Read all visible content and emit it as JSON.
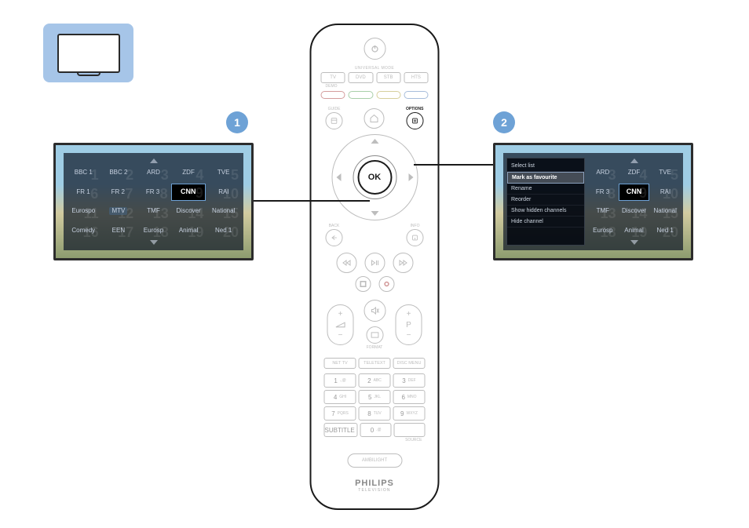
{
  "steps": {
    "one": "1",
    "two": "2"
  },
  "channel_grid": {
    "rows": [
      [
        {
          "label": "BBC 1",
          "num": "1"
        },
        {
          "label": "BBC 2",
          "num": "2"
        },
        {
          "label": "ARD",
          "num": "3"
        },
        {
          "label": "ZDF",
          "num": "4"
        },
        {
          "label": "TVE",
          "num": "5"
        }
      ],
      [
        {
          "label": "FR 1",
          "num": "6"
        },
        {
          "label": "FR 2",
          "num": "7"
        },
        {
          "label": "FR 3",
          "num": "8"
        },
        {
          "label": "CNN",
          "num": "9",
          "selected": true
        },
        {
          "label": "RAI",
          "num": "10"
        }
      ],
      [
        {
          "label": "Eurospo",
          "num": "11"
        },
        {
          "label": "MTV",
          "num": "12",
          "hover": true
        },
        {
          "label": "TMF",
          "num": "13"
        },
        {
          "label": "Discover",
          "num": "14"
        },
        {
          "label": "National",
          "num": "15"
        }
      ],
      [
        {
          "label": "Comedy",
          "num": "16"
        },
        {
          "label": "EEN",
          "num": "17"
        },
        {
          "label": "Eurosp",
          "num": "18"
        },
        {
          "label": "Animal",
          "num": "19"
        },
        {
          "label": "Ned 1",
          "num": "20"
        }
      ]
    ]
  },
  "options_menu": {
    "items": [
      {
        "label": "Select list"
      },
      {
        "label": "Mark as favourite",
        "selected": true
      },
      {
        "label": "Rename"
      },
      {
        "label": "Reorder"
      },
      {
        "label": "Show hidden channels"
      },
      {
        "label": "Hide channel"
      }
    ]
  },
  "channel_grid_right": {
    "rows": [
      [
        {
          "label": "ARD",
          "num": "3"
        },
        {
          "label": "ZDF",
          "num": "4"
        },
        {
          "label": "TVE",
          "num": "5"
        }
      ],
      [
        {
          "label": "FR 3",
          "num": "8"
        },
        {
          "label": "CNN",
          "num": "9",
          "selected": true
        },
        {
          "label": "RAI",
          "num": "10"
        }
      ],
      [
        {
          "label": "TMF",
          "num": "13"
        },
        {
          "label": "Discover",
          "num": "14"
        },
        {
          "label": "National",
          "num": "15"
        }
      ],
      [
        {
          "label": "Eurosp",
          "num": "18"
        },
        {
          "label": "Animal",
          "num": "19"
        },
        {
          "label": "Ned 1",
          "num": "20"
        }
      ]
    ]
  },
  "remote": {
    "universal_label": "UNIVERSAL MODE",
    "mode_buttons": [
      "TV",
      "DVD",
      "STB",
      "HTS"
    ],
    "mode_sub": "DEMO",
    "guide_label": "GUIDE",
    "options_label": "OPTIONS",
    "ok_label": "OK",
    "back_label": "BACK",
    "info_label": "INFO",
    "vol_plus": "+",
    "vol_minus": "−",
    "prog_label": "P",
    "format_label": "FORMAT",
    "fn_buttons": [
      "NET TV",
      "TELETEXT",
      "DISC MENU"
    ],
    "keypad": [
      [
        {
          "n": "1",
          "t": ".,@"
        },
        {
          "n": "2",
          "t": "ABC"
        },
        {
          "n": "3",
          "t": "DEF"
        }
      ],
      [
        {
          "n": "4",
          "t": "GHI"
        },
        {
          "n": "5",
          "t": "JKL"
        },
        {
          "n": "6",
          "t": "MNO"
        }
      ],
      [
        {
          "n": "7",
          "t": "PQRS"
        },
        {
          "n": "8",
          "t": "TUV"
        },
        {
          "n": "9",
          "t": "WXYZ"
        }
      ],
      [
        {
          "n": "SUBTITLE",
          "t": ""
        },
        {
          "n": "0",
          "t": ".@"
        },
        {
          "n": "",
          "t": ""
        }
      ]
    ],
    "source_label": "SOURCE",
    "ambilight": "AMBILIGHT",
    "brand": "PHILIPS",
    "brand_sub": "TELEVISION"
  }
}
